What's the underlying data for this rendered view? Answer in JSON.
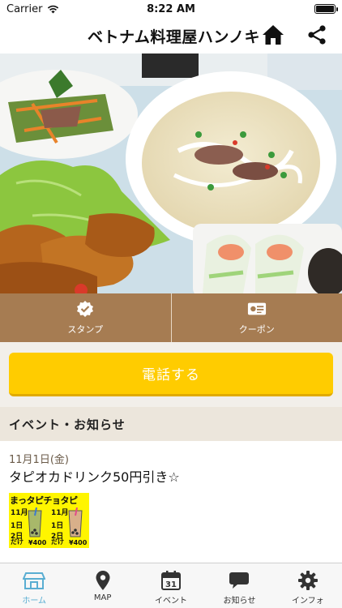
{
  "status_bar": {
    "carrier": "Carrier",
    "time": "8:22 AM",
    "battery_level": 1.0
  },
  "header": {
    "title": "ベトナム料理屋ハンノキ",
    "home_icon": "home-icon",
    "share_icon": "share-icon"
  },
  "hero": {
    "image": "vietnamese-food-photo"
  },
  "tiles": [
    {
      "label": "スタンプ",
      "icon": "check-badge-icon"
    },
    {
      "label": "クーポン",
      "icon": "coupon-card-icon"
    }
  ],
  "call_button": {
    "label": "電話する"
  },
  "section": {
    "title": "イベント・お知らせ"
  },
  "news": {
    "date": "11月1日(金)",
    "title": "タピオカドリンク50円引き☆",
    "thumbnail": {
      "title": "まっタピチョタピ",
      "lines": [
        "11月",
        "1日",
        "2日"
      ],
      "prices": [
        "¥400",
        "¥400"
      ],
      "price_prefix": "だけ"
    }
  },
  "tab_bar": {
    "active": "home",
    "colors": {
      "active": "#5aaed2",
      "inactive": "#333333"
    },
    "items": [
      {
        "key": "home",
        "label": "ホーム",
        "icon": "home-outline-icon"
      },
      {
        "key": "map",
        "label": "MAP",
        "icon": "map-pin-icon"
      },
      {
        "key": "event",
        "label": "イベント",
        "icon": "calendar-icon",
        "badge": "31"
      },
      {
        "key": "news",
        "label": "お知らせ",
        "icon": "speech-bubble-icon"
      },
      {
        "key": "info",
        "label": "インフォ",
        "icon": "gear-icon"
      }
    ]
  },
  "colors": {
    "tile_bg": "#a67c52",
    "call_button": "#ffcc00",
    "section_bg": "#ece6dc"
  }
}
